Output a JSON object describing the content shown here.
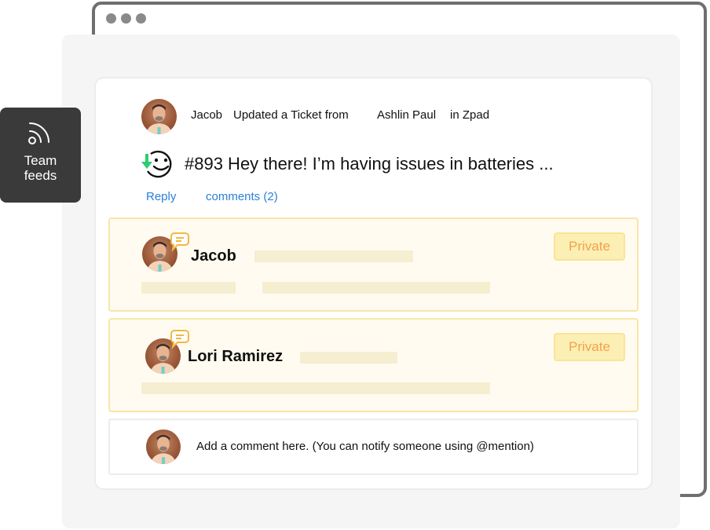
{
  "sidebar": {
    "team_feeds": {
      "label_line1": "Team",
      "label_line2": "feeds",
      "icon": "rss-feed-icon"
    }
  },
  "feed": {
    "actor": "Jacob",
    "action": "Updated a Ticket from",
    "customer": "Ashlin Paul",
    "location": "in Zpad",
    "ticket": {
      "status_icon": "happy-face-with-arrow-icon",
      "title": "#893 Hey there! I’m having issues in batteries ..."
    },
    "actions": {
      "reply": "Reply",
      "comments": "comments (2)"
    }
  },
  "comments": [
    {
      "author": "Jacob",
      "badge": "Private"
    },
    {
      "author": "Lori Ramirez",
      "badge": "Private"
    }
  ],
  "composer": {
    "placeholder": "Add a comment here. (You can notify someone using @mention)"
  },
  "colors": {
    "link": "#2b7fd9",
    "private_text": "#f2a24a",
    "private_bg": "#fcefb4",
    "comment_bg": "#fffbf0",
    "sad_arrow_green": "#2ecc71",
    "team_feeds_bg": "#3a3a3a"
  }
}
